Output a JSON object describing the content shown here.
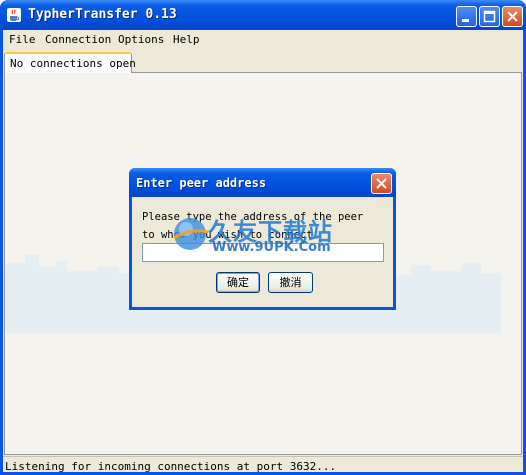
{
  "window": {
    "title": "TypherTransfer 0.13",
    "controls": [
      "minimize",
      "maximize",
      "close"
    ]
  },
  "menu": {
    "items": [
      "File",
      "Connection",
      "Options",
      "Help"
    ]
  },
  "tabs": [
    {
      "label": "No connections open",
      "active": true
    }
  ],
  "status": {
    "text": "Listening for incoming connections at port 3632..."
  },
  "dialog": {
    "title": "Enter peer address",
    "prompt_line1": "Please type the address of the peer",
    "prompt_line2": "to whom you wish to connect",
    "input_value": "",
    "ok_label": "确定",
    "cancel_label": "撤消"
  },
  "watermark": {
    "brand": "久友下载站",
    "url": "Www.9UPK.Com"
  },
  "colors": {
    "titlebar": "#0052de",
    "client": "#ece9d8",
    "close_button": "#d14b20",
    "watermark": "#1f78d7"
  }
}
